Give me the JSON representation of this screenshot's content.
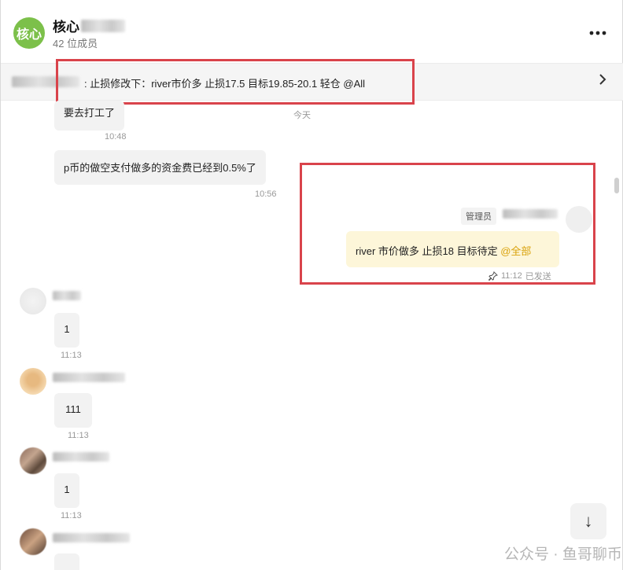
{
  "header": {
    "group_name": "核心",
    "avatar_text": "核心",
    "member_count": "42 位成员",
    "more_icon": "more-horizontal-icon"
  },
  "pinned": {
    "text": ": 止损修改下：river市价多 止损17.5 目标19.85-20.1 轻仓 @All",
    "chevron": "›"
  },
  "day_label": "今天",
  "messages": [
    {
      "text": "要去打工了",
      "time": "10:48"
    },
    {
      "text": "p币的做空支付做多的资金费已经到0.5%了",
      "time": "10:56"
    },
    {
      "text": "1",
      "time": "11:13"
    },
    {
      "text": "111",
      "time": "11:13"
    },
    {
      "text": "1",
      "time": "11:13"
    }
  ],
  "self_message": {
    "badge": "管理员",
    "text": "river  市价做多  止损18  目标待定 ",
    "mention": "@全部",
    "time": "11:12",
    "status": "已发送",
    "pin_icon": "pin-icon"
  },
  "controls": {
    "scroll_down_icon": "↓"
  },
  "watermark": "公众号 · 鱼哥聊币",
  "colors": {
    "accent_green": "#7cc04a",
    "self_bubble": "#fdf6d9",
    "mention": "#d9a20b",
    "annotation_red": "#d9434b"
  }
}
